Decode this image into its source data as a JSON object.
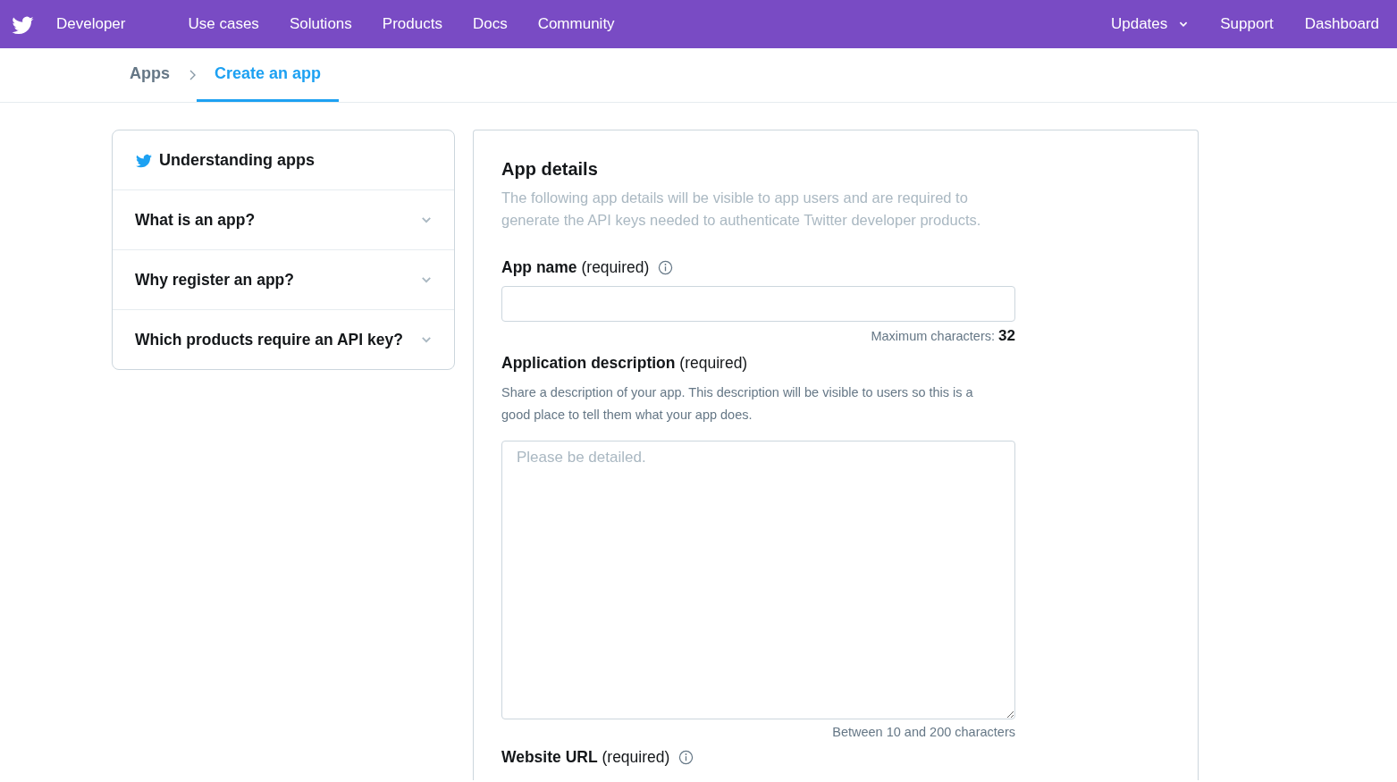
{
  "nav": {
    "brand": "Developer",
    "links": [
      "Use cases",
      "Solutions",
      "Products",
      "Docs",
      "Community"
    ],
    "right": [
      {
        "label": "Updates",
        "dropdown": true
      },
      {
        "label": "Support",
        "dropdown": false
      },
      {
        "label": "Dashboard",
        "dropdown": false
      }
    ]
  },
  "breadcrumb": [
    {
      "label": "Apps",
      "selected": false
    },
    {
      "label": "Create an app",
      "selected": true
    }
  ],
  "sidebar": {
    "title": "Understanding apps",
    "items": [
      {
        "label": "What is an app?",
        "expanded": false
      },
      {
        "label": "Why register an app?",
        "expanded": false
      },
      {
        "label": "Which products require an API key?",
        "expanded": false
      }
    ]
  },
  "form": {
    "title": "App details",
    "intro": "The following app details will be visible to app users and are required to generate the API keys needed to authenticate Twitter developer products.",
    "fields": [
      {
        "kind": "text",
        "label": "**App name** (required)",
        "info": true,
        "hint": "Maximum characters: **32**"
      },
      {
        "kind": "textarea",
        "label": "**Application description** (required)",
        "info": false,
        "description": "Share a description of your app. This description will be visible to users so this is a good place to tell them what your app does.",
        "placeholder": "Please be detailed.",
        "hint": "Between 10 and 200 characters"
      },
      {
        "kind": "label",
        "label": "**Website URL** (required)",
        "info": true
      }
    ]
  }
}
